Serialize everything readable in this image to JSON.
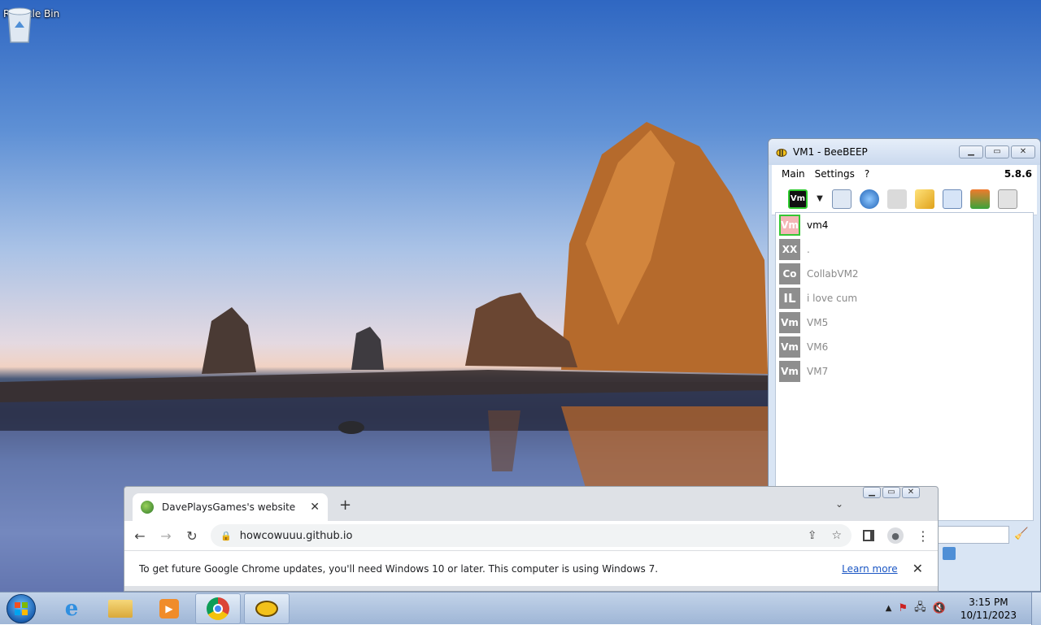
{
  "desktop": {
    "icons": [
      {
        "label": "Recycle Bin",
        "icon": "recycle-bin-icon"
      }
    ]
  },
  "beebeep": {
    "title": "VM1 - BeeBEEP",
    "version": "5.8.6",
    "menu": [
      "Main",
      "Settings",
      "?"
    ],
    "toolbar_status": "Vm",
    "users": [
      {
        "initials": "Vm",
        "name": "vm4",
        "online": true
      },
      {
        "initials": "XX",
        "name": ".",
        "online": false
      },
      {
        "initials": "Co",
        "name": "CollabVM2",
        "online": false
      },
      {
        "initials": "IL",
        "name": "i love cum",
        "online": false
      },
      {
        "initials": "Vm",
        "name": "VM5",
        "online": false
      },
      {
        "initials": "Vm",
        "name": "VM6",
        "online": false
      },
      {
        "initials": "Vm",
        "name": "VM7",
        "online": false
      }
    ]
  },
  "chrome": {
    "tab_title": "DavePlaysGames's website",
    "url": "howcowuuu.github.io",
    "infobar_text": "To get future Google Chrome updates, you'll need Windows 10 or later. This computer is using Windows 7.",
    "learn_more": "Learn more"
  },
  "taskbar": {
    "time": "3:15 PM",
    "date": "10/11/2023"
  },
  "colors": {
    "chrome_link": "#1a56c4",
    "online_border": "#35c735"
  }
}
